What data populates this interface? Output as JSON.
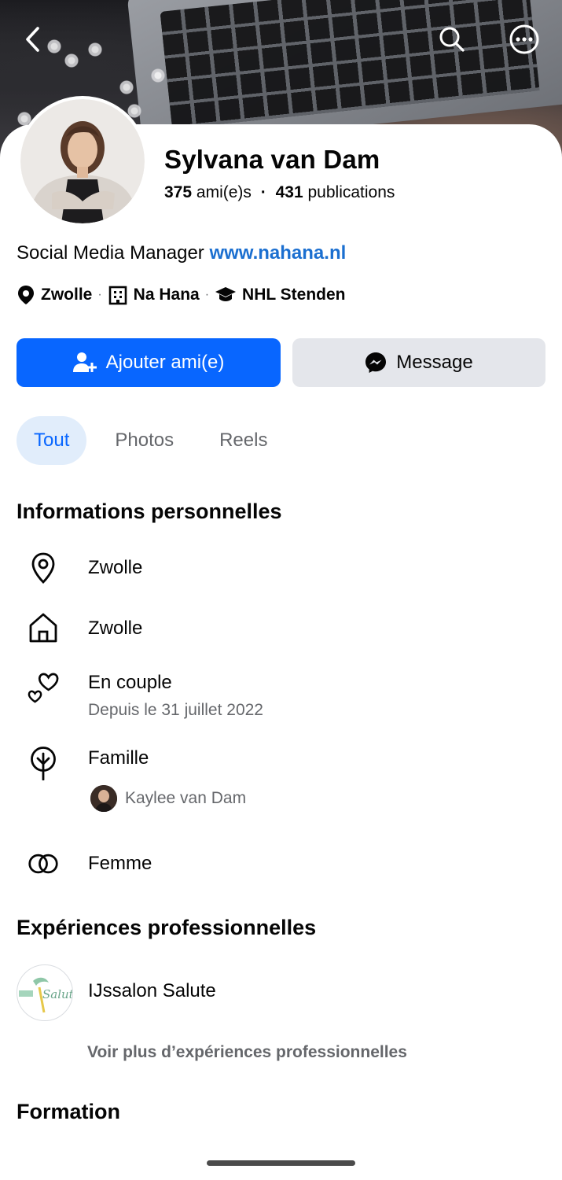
{
  "profile": {
    "name": "Sylvana van Dam",
    "friends_count": "375",
    "friends_label": "ami(e)s",
    "dot": "·",
    "posts_count": "431",
    "posts_label": "publications",
    "bio_text": "Social Media Manager",
    "bio_link": "www.nahana.nl",
    "meta": {
      "city": "Zwolle",
      "work": "Na Hana",
      "school": "NHL Stenden"
    }
  },
  "actions": {
    "add_friend": "Ajouter ami(e)",
    "message": "Message"
  },
  "tabs": [
    {
      "label": "Tout",
      "active": true
    },
    {
      "label": "Photos",
      "active": false
    },
    {
      "label": "Reels",
      "active": false
    }
  ],
  "personal_info": {
    "title": "Informations personnelles",
    "current_city": "Zwolle",
    "hometown": "Zwolle",
    "relationship": "En couple",
    "relationship_since": "Depuis le 31 juillet 2022",
    "family_title": "Famille",
    "family_member": "Kaylee van Dam",
    "gender": "Femme"
  },
  "work": {
    "title": "Expériences professionnelles",
    "employer": "IJssalon Salute",
    "logo_text": "Salute",
    "see_more": "Voir plus d’expériences professionnelles"
  },
  "education": {
    "title": "Formation"
  },
  "colors": {
    "primary": "#0866ff",
    "link": "#1b6fd0",
    "secondary_text": "#65676b",
    "button_gray": "#e4e6eb",
    "tab_active_bg": "#e1edfb"
  },
  "icons": {
    "back": "chevron-left-icon",
    "search": "search-icon",
    "more": "more-icon",
    "location": "map-pin-icon",
    "home": "home-icon",
    "relationship": "hearts-icon",
    "family": "tree-icon",
    "gender": "gender-icon"
  }
}
